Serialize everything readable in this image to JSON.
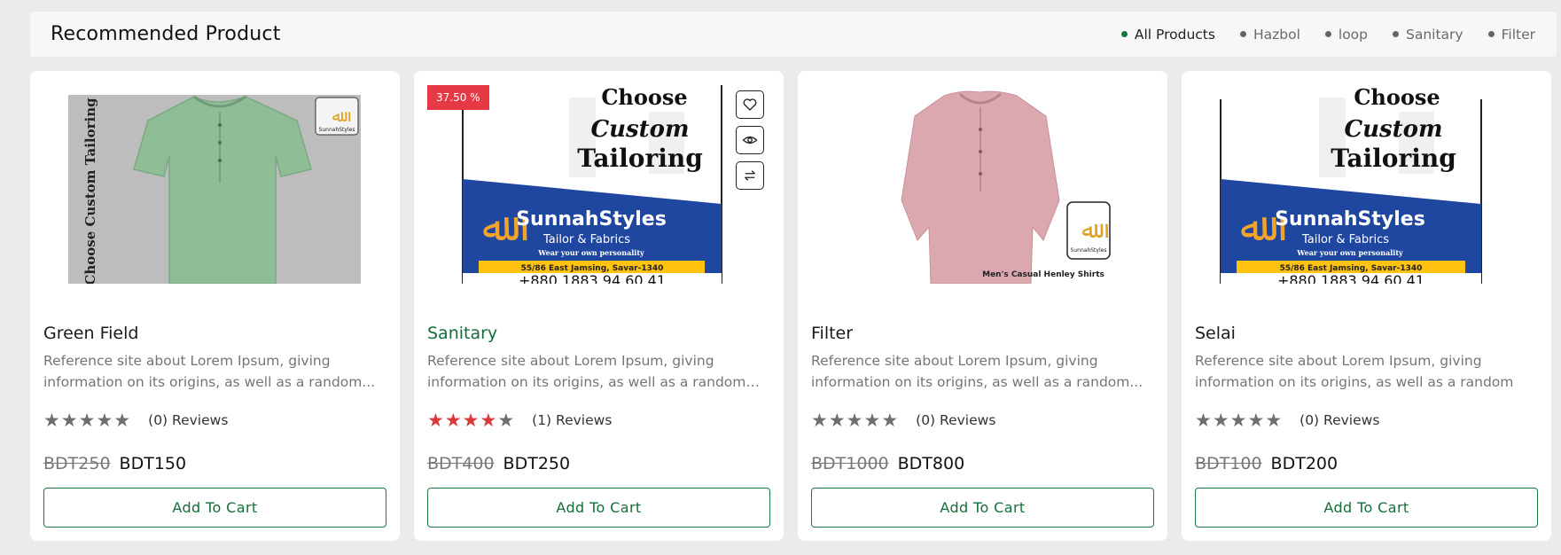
{
  "section": {
    "title": "Recommended Product"
  },
  "filters": [
    {
      "label": "All Products",
      "active": true
    },
    {
      "label": "Hazbol",
      "active": false
    },
    {
      "label": "loop",
      "active": false
    },
    {
      "label": "Sanitary",
      "active": false
    },
    {
      "label": "Filter",
      "active": false
    }
  ],
  "colors": {
    "accent": "#136e38",
    "badge": "#e63946",
    "star_on": "#d83a3a",
    "star_off": "#6f6f6f"
  },
  "products": [
    {
      "title": "Green Field",
      "description": "Reference site about Lorem Ipsum, giving information on its origins, as well as a random...",
      "rating": 0,
      "reviews": "(0) Reviews",
      "old_price": "BDT250",
      "new_price": "BDT150",
      "button": "Add To Cart",
      "image": "green-shirt-image"
    },
    {
      "title": "Sanitary",
      "description": "Reference site about Lorem Ipsum, giving information on its origins, as well as a random gom...",
      "rating": 4,
      "reviews": "(1) Reviews",
      "old_price": "BDT400",
      "new_price": "BDT250",
      "button": "Add To Cart",
      "badge": "37.50 %",
      "image": "tailoring-banner-image"
    },
    {
      "title": "Filter",
      "description": "Reference site about Lorem Ipsum, giving information on its origins, as well as a random...",
      "rating": 0,
      "reviews": "(0) Reviews",
      "old_price": "BDT1000",
      "new_price": "BDT800",
      "button": "Add To Cart",
      "image": "pink-shirt-image",
      "image_caption": "Men's Casual Henley Shirts"
    },
    {
      "title": "Selai",
      "description": "Reference site about Lorem Ipsum, giving information on its origins, as well as a random",
      "rating": 0,
      "reviews": "(0) Reviews",
      "old_price": "BDT100",
      "new_price": "BDT200",
      "button": "Add To Cart",
      "image": "tailoring-banner-image"
    }
  ],
  "banner": {
    "headline_1": "Choose",
    "headline_2": "Custom",
    "headline_3": "Tailoring",
    "brand": "SunnahStyles",
    "sub": "Tailor & Fabrics",
    "tagline": "Wear your own personality",
    "address": "55/86 East Jamsing, Savar-1340",
    "phone": "+880 1883 94 60 41"
  },
  "shirt_text": "Choose Custom Tailoring",
  "logo_text": "SunnahStyles"
}
